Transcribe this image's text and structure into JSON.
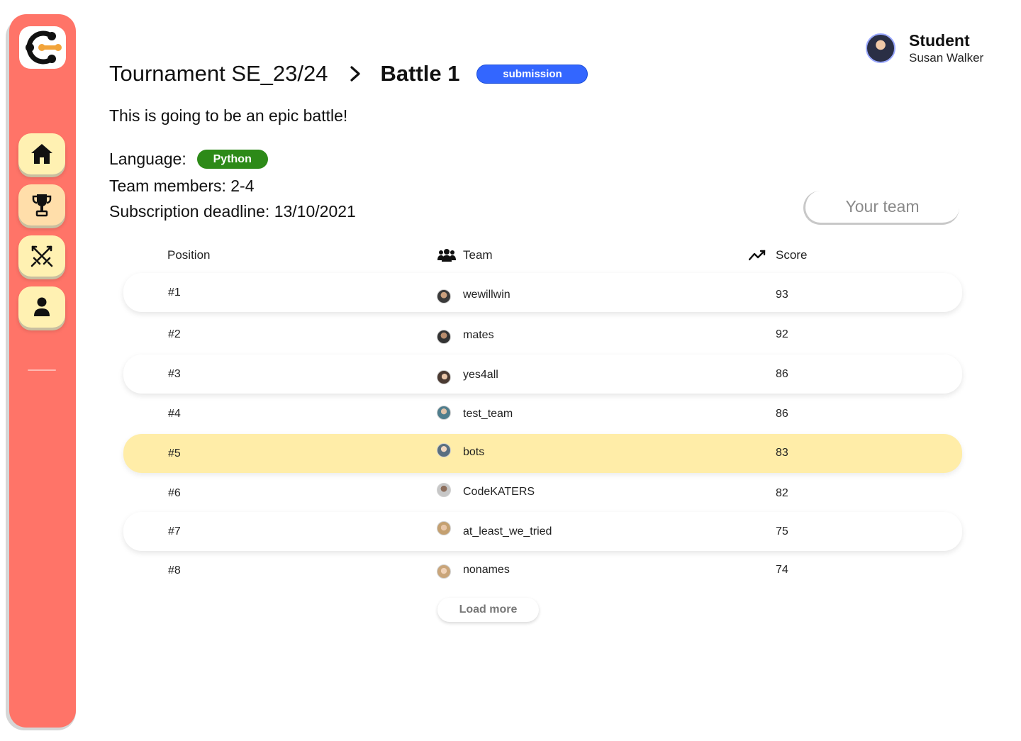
{
  "sidebar": {
    "logo_icon": "codekata-logo-icon",
    "items": [
      {
        "icon": "home-icon",
        "label": "Home"
      },
      {
        "icon": "trophy-icon",
        "label": "Tournaments"
      },
      {
        "icon": "swords-icon",
        "label": "Battles"
      },
      {
        "icon": "user-icon",
        "label": "Profile"
      }
    ]
  },
  "header": {
    "tournament": "Tournament SE_23/24",
    "battle": "Battle 1",
    "status": "submission"
  },
  "user": {
    "role": "Student",
    "name": "Susan Walker"
  },
  "battle": {
    "description": "This is going to be an epic battle!",
    "language_label": "Language:",
    "language": "Python",
    "team_members": "Team members: 2-4",
    "deadline": "Subscription deadline: 13/10/2021"
  },
  "your_team_button": "Your team",
  "table": {
    "headers": {
      "position": "Position",
      "team": "Team",
      "score": "Score"
    },
    "rows": [
      {
        "position": "#1",
        "team": "wewillwin",
        "score": "93"
      },
      {
        "position": "#2",
        "team": "mates",
        "score": "92"
      },
      {
        "position": "#3",
        "team": "yes4all",
        "score": "86"
      },
      {
        "position": "#4",
        "team": "test_team",
        "score": "86"
      },
      {
        "position": "#5",
        "team": "bots",
        "score": "83"
      },
      {
        "position": "#6",
        "team": "CodeKATERS",
        "score": "82"
      },
      {
        "position": "#7",
        "team": "at_least_we_tried",
        "score": "75"
      },
      {
        "position": "#8",
        "team": "nonames",
        "score": "74"
      }
    ]
  },
  "load_more": "Load more",
  "colors": {
    "sidebar": "#ff7468",
    "status_pill": "#3366ff",
    "language_pill": "#2d8a18",
    "highlight_row": "#ffeda8"
  }
}
